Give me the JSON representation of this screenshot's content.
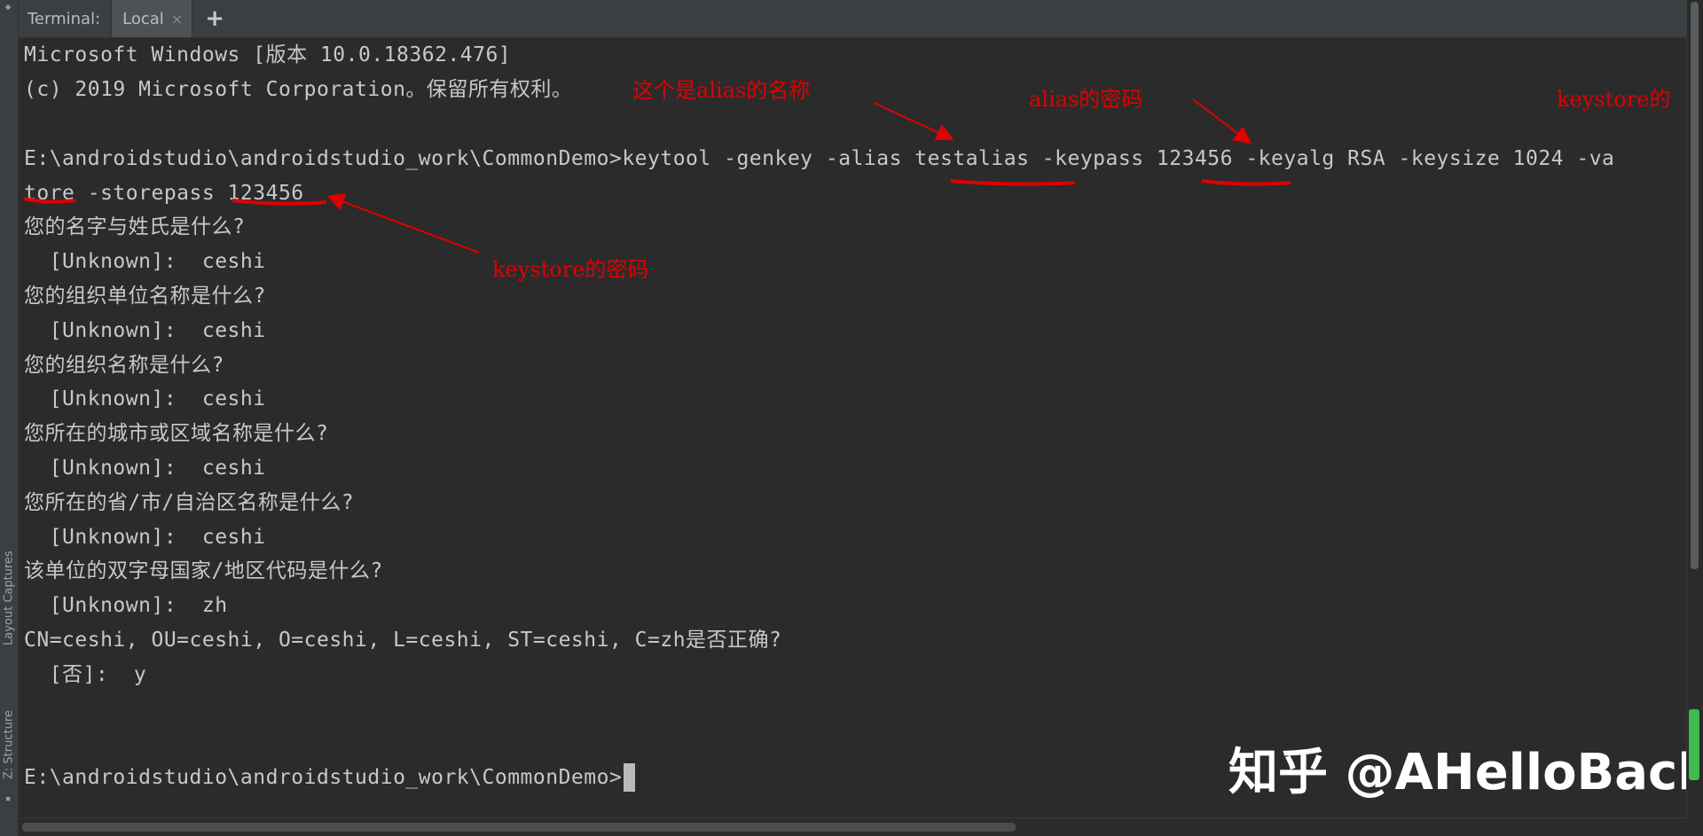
{
  "tabbar": {
    "title": "Terminal:",
    "tab_label": "Local",
    "close_glyph": "×",
    "add_glyph": "+"
  },
  "side_tabs": {
    "layout_captures": "Layout Captures",
    "structure": "Z: Structure"
  },
  "terminal": {
    "lines": [
      "Microsoft Windows [版本 10.0.18362.476]",
      "(c) 2019 Microsoft Corporation。保留所有权利。",
      "",
      "E:\\androidstudio\\androidstudio_work\\CommonDemo>keytool -genkey -alias testalias -keypass 123456 -keyalg RSA -keysize 1024 -va",
      "tore -storepass 123456",
      "您的名字与姓氏是什么?",
      "  [Unknown]:  ceshi",
      "您的组织单位名称是什么?",
      "  [Unknown]:  ceshi",
      "您的组织名称是什么?",
      "  [Unknown]:  ceshi",
      "您所在的城市或区域名称是什么?",
      "  [Unknown]:  ceshi",
      "您所在的省/市/自治区名称是什么?",
      "  [Unknown]:  ceshi",
      "该单位的双字母国家/地区代码是什么?",
      "  [Unknown]:  zh",
      "CN=ceshi, OU=ceshi, O=ceshi, L=ceshi, ST=ceshi, C=zh是否正确?",
      "  [否]:  y",
      "",
      "",
      "E:\\androidstudio\\androidstudio_work\\CommonDemo>"
    ]
  },
  "annotations": {
    "alias_name": "这个是alias的名称",
    "alias_password": "alias的密码",
    "keystore_cut": "keystore的",
    "keystore_password": "keystore的密码"
  },
  "watermark": "知乎 @AHelloBack",
  "colors": {
    "background": "#2b2b2b",
    "text": "#c8c8c8",
    "annotation": "#e00000"
  }
}
